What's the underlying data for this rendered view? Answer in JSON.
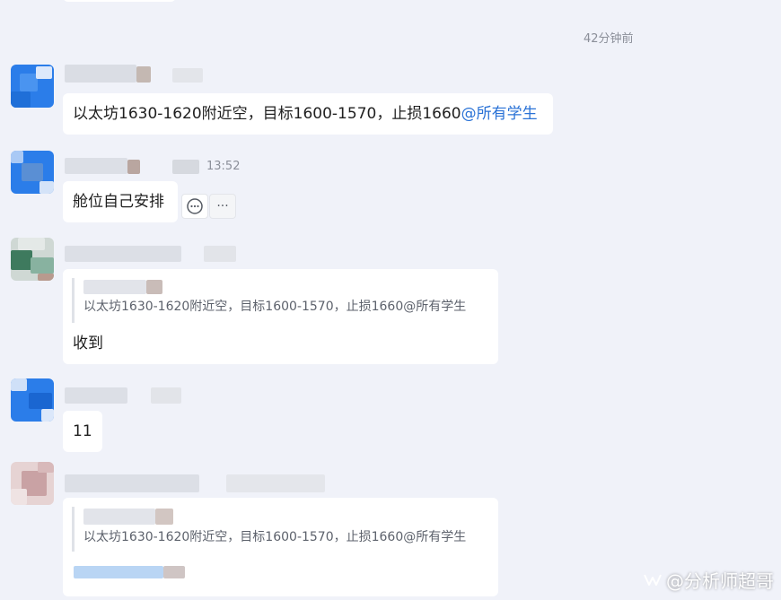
{
  "timestamps": {
    "top_relative": "42分钟前",
    "msg2_time": "13:52"
  },
  "messages": [
    {
      "text": "以太坊1630-1620附近空，目标1600-1570，止损1660",
      "mention": "@所有学生"
    },
    {
      "text": "舱位自己安排"
    },
    {
      "quote": "以太坊1630-1620附近空，目标1600-1570，止损1660@所有学生",
      "text": "收到"
    },
    {
      "text": "11"
    },
    {
      "quote": "以太坊1630-1620附近空，目标1600-1570，止损1660@所有学生"
    }
  ],
  "actions": {
    "reply_icon": "comment-bubble-icon",
    "more_icon": "more-dots-icon",
    "more_glyph": "···"
  },
  "watermark": {
    "text": "@分析师超哥",
    "icon": "wechat-channel-icon"
  },
  "colors": {
    "background": "#f0f2f9",
    "bubble": "#ffffff",
    "mention": "#2a72d6",
    "timestamp": "#8b8f99"
  }
}
